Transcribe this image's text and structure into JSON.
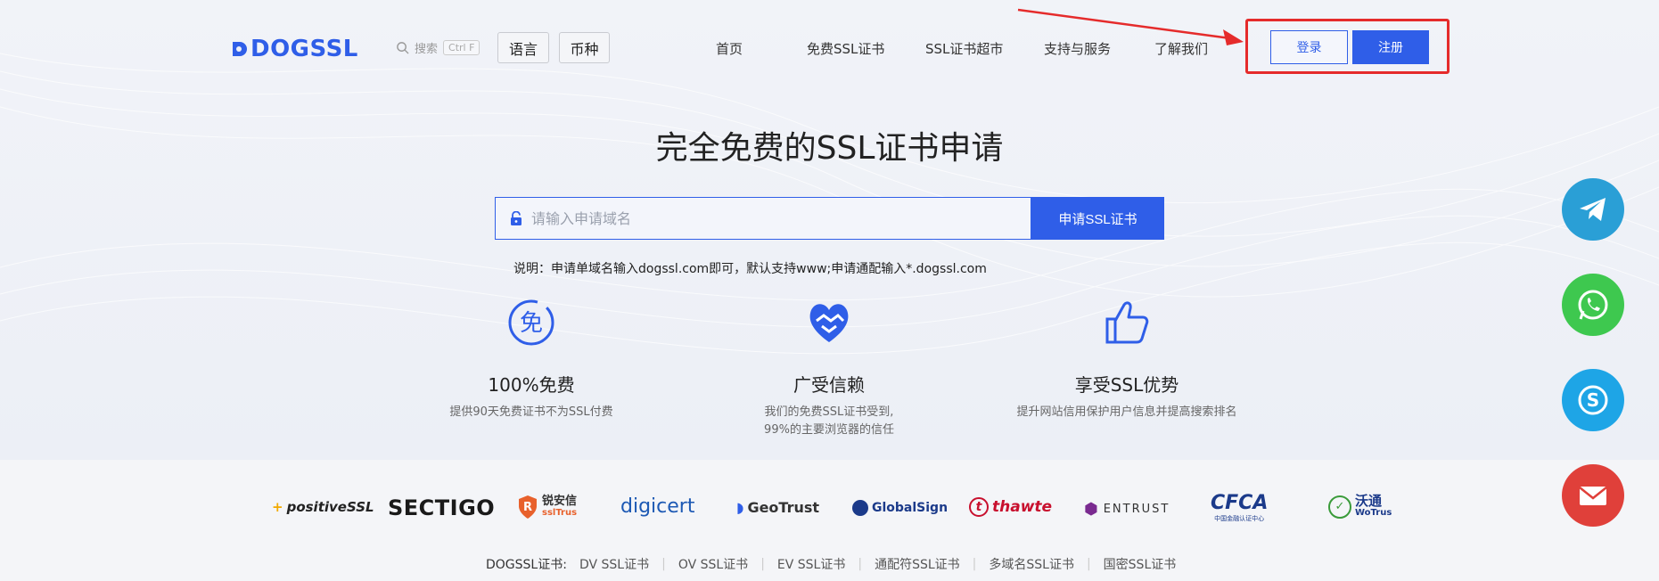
{
  "header": {
    "logo": "DOGSSL",
    "search_label": "搜索",
    "search_shortcut": "Ctrl F",
    "language_btn": "语言",
    "currency_btn": "币种",
    "nav": [
      "首页",
      "免费SSL证书",
      "SSL证书超市",
      "支持与服务",
      "了解我们"
    ],
    "login": "登录",
    "register": "注册"
  },
  "hero": {
    "title": "完全免费的SSL证书申请",
    "placeholder": "请输入申请域名",
    "apply_btn": "申请SSL证书",
    "hint": "说明：申请单域名输入dogssl.com即可，默认支持www;申请通配输入*.dogssl.com"
  },
  "features": [
    {
      "title": "100%免费",
      "desc": "提供90天免费证书不为SSL付费",
      "desc2": "",
      "icon": "free-badge-icon"
    },
    {
      "title": "广受信赖",
      "desc": "我们的免费SSL证书受到,",
      "desc2": "99%的主要浏览器的信任",
      "icon": "handshake-heart-icon"
    },
    {
      "title": "享受SSL优势",
      "desc": "提升网站信用保护用户信息并提高搜索排名",
      "desc2": "",
      "icon": "thumbs-up-icon"
    }
  ],
  "brands": [
    "positiveSSL",
    "SECTIGO",
    "锐安信",
    "sslTrus",
    "digicert",
    "GeoTrust",
    "GlobalSign",
    "thawte",
    "ENTRUST",
    "CFCA",
    "中国金融认证中心",
    "沃通",
    "WoTrus"
  ],
  "footer": {
    "label": "DOGSSL证书:",
    "links": [
      "DV SSL证书",
      "OV SSL证书",
      "EV SSL证书",
      "通配符SSL证书",
      "多域名SSL证书",
      "国密SSL证书"
    ]
  },
  "colors": {
    "primary": "#2f5ee8",
    "highlight": "#e52b2b",
    "telegram": "#2a9fd6",
    "whatsapp": "#3ec84f",
    "skype": "#1ea5e6",
    "email": "#e0403a"
  },
  "social": [
    "telegram-icon",
    "whatsapp-icon",
    "skype-icon",
    "email-icon"
  ]
}
